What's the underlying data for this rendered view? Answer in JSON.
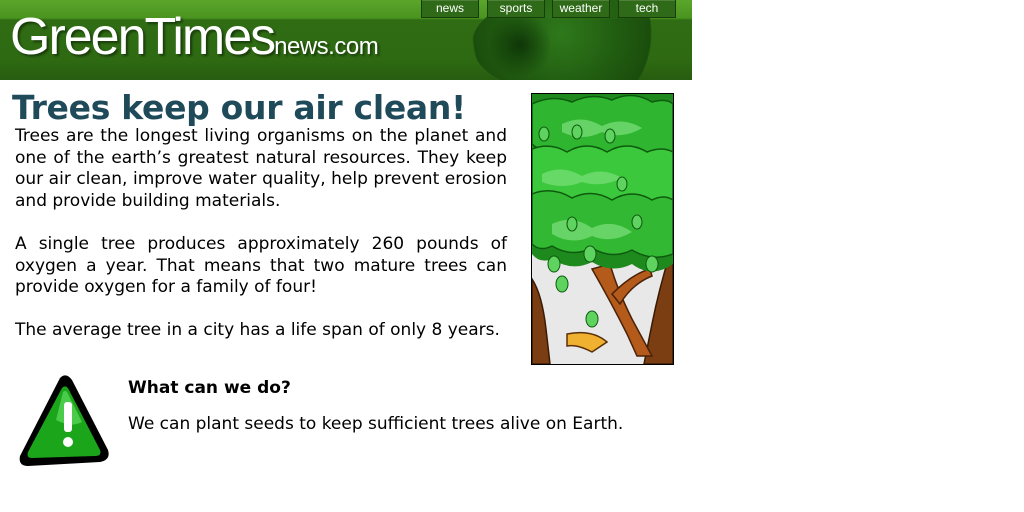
{
  "header": {
    "logo_main": "GreenTimes",
    "logo_suffix": "news.com",
    "nav": [
      {
        "label": "news"
      },
      {
        "label": "sports"
      },
      {
        "label": "weather"
      },
      {
        "label": "tech"
      }
    ],
    "colors": {
      "header_green": "#2e6a12",
      "header_light": "#5aa62a"
    }
  },
  "article": {
    "headline": "Trees keep our air clean!",
    "headline_color": "#1f4a5a",
    "paragraphs": [
      "Trees are the longest living organisms on the planet and one of the earth’s greatest natural resources. They keep our air clean, improve water quality, help prevent erosion and provide building materials.",
      "A single tree produces approximately 260 pounds of oxygen a year. That means that two mature trees can provide oxygen for a family of four!",
      "The average tree in a city has a life span of only 8 years."
    ],
    "image": "tree-illustration"
  },
  "callout": {
    "icon": "warning-icon",
    "title": "What can we do?",
    "text": "We can plant seeds to keep sufficient trees alive on Earth."
  }
}
